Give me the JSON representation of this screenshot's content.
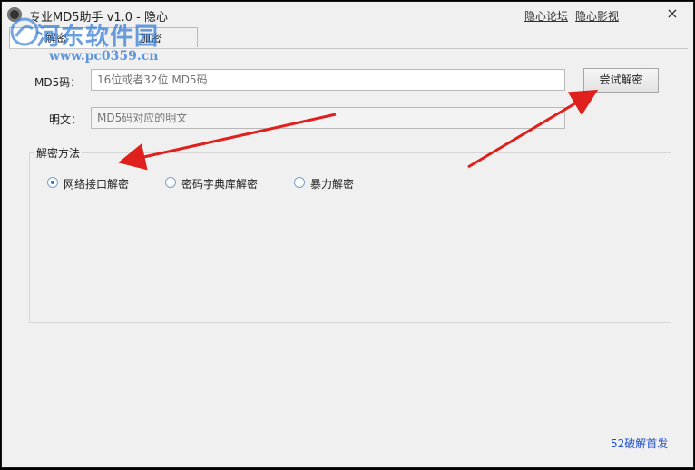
{
  "window": {
    "title": "专业MD5助手 v1.0 - 隐心",
    "links": {
      "forum": "隐心论坛",
      "film": "隐心影视"
    },
    "close_symbol": "×"
  },
  "watermark": {
    "name": "河东软件园",
    "url": "www.pc0359.cn"
  },
  "tabs": [
    {
      "label": "解密"
    },
    {
      "label": "加密"
    }
  ],
  "form": {
    "md5_label": "MD5码：",
    "md5_placeholder": "16位或者32位 MD5码",
    "plain_label": "明文：",
    "plain_placeholder": "MD5码对应的明文",
    "try_button": "尝试解密"
  },
  "method": {
    "title": "解密方法",
    "options": [
      {
        "label": "网络接口解密",
        "selected": true
      },
      {
        "label": "密码字典库解密",
        "selected": false
      },
      {
        "label": "暴力解密",
        "selected": false
      }
    ]
  },
  "footer": {
    "credit": "52破解首发"
  },
  "colors": {
    "arrow": "#e0201c",
    "link": "#1a4fd0",
    "watermark": "#3a7fd6"
  }
}
